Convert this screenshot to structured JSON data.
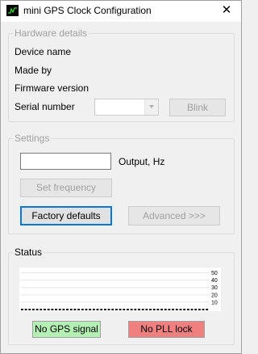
{
  "window": {
    "title": "mini GPS Clock Configuration",
    "close_glyph": "✕"
  },
  "hardware": {
    "group_label": "Hardware details",
    "device_name_label": "Device name",
    "made_by_label": "Made by",
    "firmware_label": "Firmware version",
    "serial_label": "Serial number",
    "serial_value": "",
    "blink_label": "Blink"
  },
  "settings": {
    "group_label": "Settings",
    "frequency_value": "",
    "output_label": "Output, Hz",
    "set_frequency_label": "Set frequency",
    "factory_defaults_label": "Factory defaults",
    "advanced_label": "Advanced >>>"
  },
  "status": {
    "group_label": "Status",
    "gps_label": "No GPS signal",
    "pll_label": "No PLL lock",
    "gps_color": "#b4f0b4",
    "pll_color": "#f08080"
  },
  "chart_data": {
    "type": "line",
    "yticks": [
      "50",
      "40",
      "30",
      "20",
      "10"
    ],
    "ylim": [
      0,
      55
    ],
    "values": [
      0,
      0,
      0,
      0,
      0,
      0,
      0,
      0,
      0,
      0,
      0,
      0,
      0,
      0,
      0,
      0,
      0,
      0,
      0,
      0,
      0,
      0,
      0,
      0,
      0,
      0,
      0,
      0,
      0,
      0,
      0,
      0,
      0,
      0,
      0,
      0,
      0,
      0,
      0,
      0,
      0,
      0,
      0,
      0,
      0,
      0,
      0,
      0,
      0,
      0
    ],
    "grid": true
  },
  "icons": {
    "app": "oscilloscope-icon",
    "combo_arrow": "chevron-down-icon"
  }
}
